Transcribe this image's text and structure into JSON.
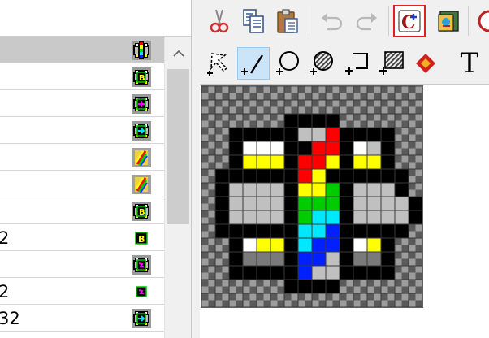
{
  "list": {
    "rows": [
      {
        "text": "",
        "icon": "rainbow-clover-icon",
        "selected": true
      },
      {
        "text": "",
        "icon": "clover-b-icon",
        "selected": false
      },
      {
        "text": "",
        "icon": "clover-plus-icon",
        "selected": false
      },
      {
        "text": "",
        "icon": "clover-arrow-icon",
        "selected": false
      },
      {
        "text": "",
        "icon": "rainbow-stripe-icon",
        "selected": false
      },
      {
        "text": "",
        "icon": "rainbow-stripe-icon",
        "selected": false
      },
      {
        "text": "",
        "icon": "clover-b-icon",
        "selected": false
      },
      {
        "text": "2",
        "icon": "b-badge-icon",
        "selected": false
      },
      {
        "text": "",
        "icon": "clover-lightning-icon",
        "selected": false
      },
      {
        "text": "2",
        "icon": "lightning-badge-icon",
        "selected": false
      },
      {
        "text": "32",
        "icon": "clover-arrow-icon",
        "selected": false
      }
    ]
  },
  "toolbar1": {
    "buttons": [
      "cut-icon",
      "copy-icon",
      "paste-icon",
      "undo-icon",
      "redo-icon",
      "color-picker-icon",
      "icon-properties-icon"
    ]
  },
  "toolbar2": {
    "buttons": [
      "lasso-select-icon",
      "line-tool-icon",
      "ellipse-tool-icon",
      "fill-ellipse-tool-icon",
      "rectangle-tool-icon",
      "fill-rectangle-tool-icon",
      "diamond-tool-icon",
      "text-tool-icon"
    ],
    "text_tool_label": "T"
  },
  "colors": {
    "selection_bg": "#c9c9c9",
    "active_tool_bg": "#cce4f7",
    "highlight_frame": "#e02020"
  }
}
